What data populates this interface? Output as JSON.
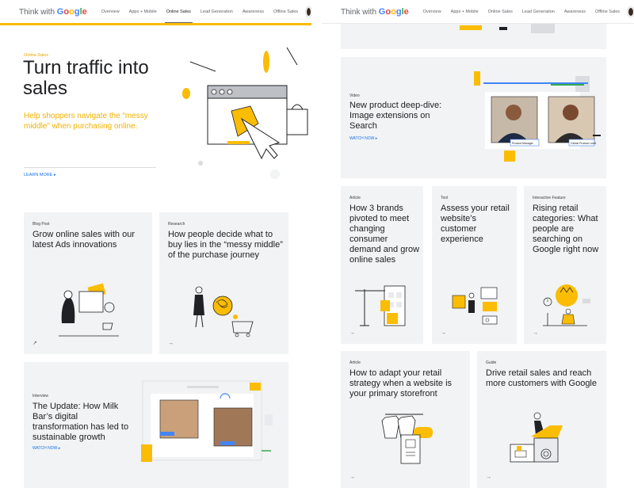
{
  "nav": {
    "brand_prefix": "Think with ",
    "brand_google": [
      "G",
      "o",
      "o",
      "g",
      "l",
      "e"
    ],
    "items": [
      "Overview",
      "Apps + Mobile",
      "Online Sales",
      "Lead Generation",
      "Awareness",
      "Offline Sales"
    ],
    "active": "Online Sales"
  },
  "hero": {
    "eyebrow": "Online Sales",
    "title": "Turn traffic into sales",
    "subtitle": "Help shoppers navigate the “messy middle” when purchasing online.",
    "cta": "LEARN MORE"
  },
  "left_cards": [
    {
      "eyebrow": "Blog Post",
      "title": "Grow online sales with our latest Ads innovations"
    },
    {
      "eyebrow": "Research",
      "title": "How people decide what to buy lies in the “messy middle” of the purchase journey"
    },
    {
      "eyebrow": "Interview",
      "title": "The Update: How Milk Bar’s digital transformation has led to sustainable growth",
      "cta": "WATCH NOW"
    }
  ],
  "right_cards": [
    {
      "eyebrow": "Video",
      "title": "New product deep-dive: Image extensions on Search",
      "cta": "WATCH NOW"
    },
    {
      "eyebrow": "Article",
      "title": "How 3 brands pivoted to meet changing consumer demand and grow online sales"
    },
    {
      "eyebrow": "Tool",
      "title": "Assess your retail website’s customer experience"
    },
    {
      "eyebrow": "Interactive Feature",
      "title": "Rising retail categories: What people are searching on Google right now"
    },
    {
      "eyebrow": "Article",
      "title": "How to adapt your retail strategy when a website is your primary storefront"
    },
    {
      "eyebrow": "Guide",
      "title": "Drive retail sales and reach more customers with Google"
    }
  ],
  "video_captions": {
    "person1": "Product Manager",
    "person2": "Global Product Lead"
  },
  "icons": {
    "arrow": "→",
    "external": "↗",
    "chevron": "▸"
  },
  "colors": {
    "accent_yellow": "#fbbc04",
    "link_blue": "#1a73e8",
    "card_bg": "#f1f3f4"
  }
}
